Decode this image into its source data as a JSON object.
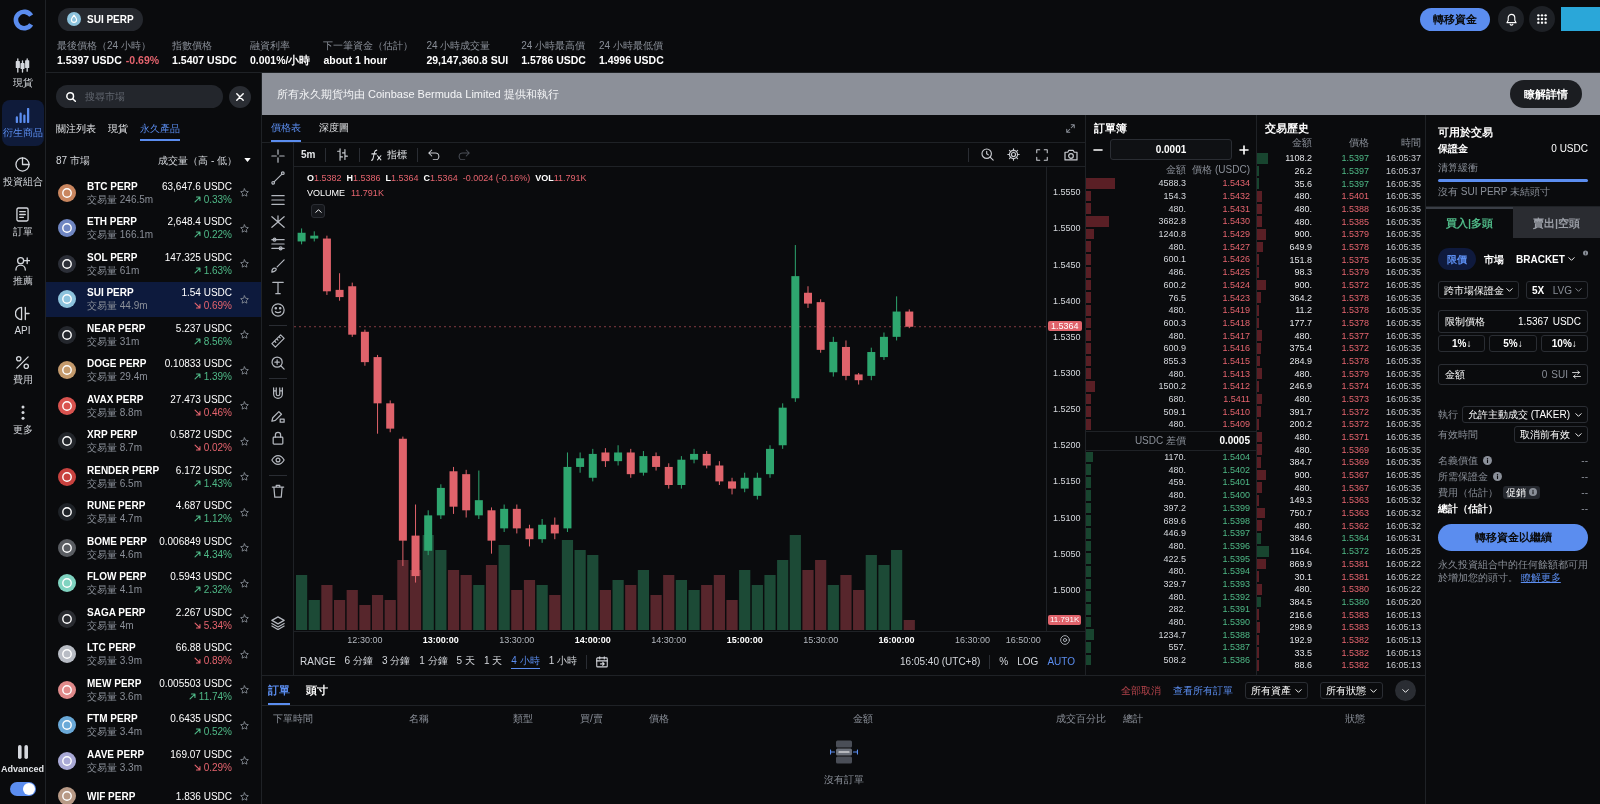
{
  "sidebar": {
    "items": [
      {
        "label": "現貨",
        "selected": false
      },
      {
        "label": "衍生商品",
        "selected": true
      },
      {
        "label": "投資組合",
        "selected": false
      },
      {
        "label": "訂單",
        "selected": false
      },
      {
        "label": "推薦",
        "selected": false
      },
      {
        "label": "API",
        "selected": false
      },
      {
        "label": "費用",
        "selected": false
      },
      {
        "label": "更多",
        "selected": false
      }
    ],
    "mode_label": "Advanced",
    "mode_toggle": {
      "on": true
    }
  },
  "header": {
    "market": "SUI PERP",
    "stats": [
      {
        "label": "最後價格（24 小時）",
        "value": "1.5397 USDC",
        "change": "-0.69%"
      },
      {
        "label": "指數價格",
        "value": "1.5407 USDC"
      },
      {
        "label": "融資利率",
        "value": "0.001%/小時"
      },
      {
        "label": "下一筆資金（估計）",
        "value": "about 1 hour"
      },
      {
        "label": "24 小時成交量",
        "value": "29,147,360.8 SUI"
      },
      {
        "label": "24 小時最高價",
        "value": "1.5786 USDC"
      },
      {
        "label": "24 小時最低價",
        "value": "1.4996 USDC"
      }
    ],
    "transfer_button": "轉移資金"
  },
  "markets": {
    "search": {
      "placeholder": "搜尋市場"
    },
    "tabs": [
      {
        "label": "關注列表",
        "selected": false
      },
      {
        "label": "現貨",
        "selected": false
      },
      {
        "label": "永久產品",
        "selected": true
      }
    ],
    "count": "87 市場",
    "sort": "成交量（高 - 低）",
    "rows": [
      {
        "name": "BTC PERP",
        "volume": "交易量 246.5m",
        "price": "63,647.6 USDC",
        "change": "0.33%",
        "rising": true,
        "selected": false,
        "color": "#c9865f"
      },
      {
        "name": "ETH PERP",
        "volume": "交易量 166.1m",
        "price": "2,648.4 USDC",
        "change": "0.22%",
        "rising": true,
        "selected": false,
        "color": "#6f86c2"
      },
      {
        "name": "SOL PERP",
        "volume": "交易量 61m",
        "price": "147.325 USDC",
        "change": "1.63%",
        "rising": true,
        "selected": false,
        "color": "#2c2f38"
      },
      {
        "name": "SUI PERP",
        "volume": "交易量 44.9m",
        "price": "1.54 USDC",
        "change": "0.69%",
        "rising": false,
        "selected": true,
        "color": "#8dc3dd"
      },
      {
        "name": "NEAR PERP",
        "volume": "交易量 31m",
        "price": "5.237 USDC",
        "change": "8.56%",
        "rising": true,
        "selected": false,
        "color": "#24272d"
      },
      {
        "name": "DOGE PERP",
        "volume": "交易量 29.4m",
        "price": "0.10833 USDC",
        "change": "1.39%",
        "rising": true,
        "selected": false,
        "color": "#c49a6c"
      },
      {
        "name": "AVAX PERP",
        "volume": "交易量 8.8m",
        "price": "27.473 USDC",
        "change": "0.46%",
        "rising": false,
        "selected": false,
        "color": "#d9534f"
      },
      {
        "name": "XRP PERP",
        "volume": "交易量 8.7m",
        "price": "0.5872 USDC",
        "change": "0.02%",
        "rising": false,
        "selected": false,
        "color": "#23262b"
      },
      {
        "name": "RENDER PERP",
        "volume": "交易量 6.5m",
        "price": "6.172 USDC",
        "change": "1.43%",
        "rising": true,
        "selected": false,
        "color": "#c8423f"
      },
      {
        "name": "RUNE PERP",
        "volume": "交易量 4.7m",
        "price": "4.687 USDC",
        "change": "1.12%",
        "rising": true,
        "selected": false,
        "color": "#1f2328"
      },
      {
        "name": "BOME PERP",
        "volume": "交易量 4.6m",
        "price": "0.006849 USDC",
        "change": "4.34%",
        "rising": true,
        "selected": false,
        "color": "#5a5d62"
      },
      {
        "name": "FLOW PERP",
        "volume": "交易量 4.1m",
        "price": "0.5943 USDC",
        "change": "2.32%",
        "rising": true,
        "selected": false,
        "color": "#7fd3c0"
      },
      {
        "name": "SAGA PERP",
        "volume": "交易量 4m",
        "price": "2.267 USDC",
        "change": "5.34%",
        "rising": false,
        "selected": false,
        "color": "#2a2c31"
      },
      {
        "name": "LTC PERP",
        "volume": "交易量 3.9m",
        "price": "66.88 USDC",
        "change": "0.89%",
        "rising": false,
        "selected": false,
        "color": "#b8bcc4"
      },
      {
        "name": "MEW PERP",
        "volume": "交易量 3.6m",
        "price": "0.005503 USDC",
        "change": "11.74%",
        "rising": true,
        "selected": false,
        "color": "#e08a8a"
      },
      {
        "name": "FTM PERP",
        "volume": "交易量 3.4m",
        "price": "0.6435 USDC",
        "change": "0.52%",
        "rising": true,
        "selected": false,
        "color": "#6aa9d8"
      },
      {
        "name": "AAVE PERP",
        "volume": "交易量 3.3m",
        "price": "169.07 USDC",
        "change": "0.29%",
        "rising": false,
        "selected": false,
        "color": "#a9a9d6"
      },
      {
        "name": "WIF PERP",
        "price": "1.836 USDC",
        "selected": false,
        "color": "#b89a86"
      }
    ]
  },
  "banner": {
    "text": "所有永久期貨均由 Coinbase Bermuda Limited 提供和執行",
    "button": "瞭解詳情"
  },
  "chart": {
    "tabs": [
      {
        "label": "價格表",
        "selected": true
      },
      {
        "label": "深度圖",
        "selected": false
      }
    ],
    "interval": "5m",
    "indicators_button": "指標",
    "legend": {
      "ohlc": [
        {
          "key": "O",
          "value": "1.5382"
        },
        {
          "key": "H",
          "value": "1.5386"
        },
        {
          "key": "L",
          "value": "1.5364"
        },
        {
          "key": "C",
          "value": "1.5364"
        }
      ],
      "change": "-0.0024 (-0.16%)",
      "volume_key": "VOL",
      "volume_value": "11.791K"
    },
    "volume_legend": {
      "label": "VOLUME",
      "value": "11.791K"
    },
    "chart_data": {
      "type": "candlestick",
      "x": [
        725,
        730,
        735,
        740,
        745,
        750,
        755,
        760,
        765,
        770,
        775,
        780,
        785,
        790,
        795,
        800,
        805,
        810,
        815,
        820,
        825,
        830,
        835,
        840,
        845,
        850,
        855,
        860,
        865,
        870,
        875,
        880,
        885,
        890,
        895,
        900,
        905,
        910,
        915,
        920,
        925,
        930,
        935,
        940,
        945,
        950,
        955,
        960,
        965
      ],
      "ohlc": [
        [
          1.5482,
          1.55,
          1.5478,
          1.5494
        ],
        [
          1.5486,
          1.5496,
          1.5482,
          1.549
        ],
        [
          1.5486,
          1.549,
          1.5408,
          1.5413
        ],
        [
          1.5415,
          1.5438,
          1.54,
          1.5405
        ],
        [
          1.542,
          1.5425,
          1.535,
          1.5353
        ],
        [
          1.5357,
          1.536,
          1.531,
          1.5315
        ],
        [
          1.5322,
          1.5325,
          1.5216,
          1.5258
        ],
        [
          1.5258,
          1.5262,
          1.5218,
          1.5223
        ],
        [
          1.5209,
          1.5212,
          1.5033,
          1.5068
        ],
        [
          1.5075,
          1.5118,
          1.501,
          1.5019
        ],
        [
          1.5054,
          1.511,
          1.5048,
          1.5103
        ],
        [
          1.5103,
          1.5146,
          1.5098,
          1.5141
        ],
        [
          1.5164,
          1.517,
          1.5105,
          1.5115
        ],
        [
          1.516,
          1.5166,
          1.51,
          1.511
        ],
        [
          1.5103,
          1.5165,
          1.5098,
          1.5124
        ],
        [
          1.511,
          1.5114,
          1.505,
          1.5068
        ],
        [
          1.5085,
          1.5118,
          1.508,
          1.5112
        ],
        [
          1.5112,
          1.5118,
          1.5078,
          1.5085
        ],
        [
          1.5085,
          1.509,
          1.506,
          1.507
        ],
        [
          1.507,
          1.5098,
          1.5065,
          1.509
        ],
        [
          1.509,
          1.51,
          1.507,
          1.5078
        ],
        [
          1.5085,
          1.519,
          1.508,
          1.517
        ],
        [
          1.517,
          1.519,
          1.5162,
          1.5182
        ],
        [
          1.5155,
          1.5195,
          1.515,
          1.5188
        ],
        [
          1.519,
          1.5196,
          1.517,
          1.5178
        ],
        [
          1.5178,
          1.52,
          1.5172,
          1.519
        ],
        [
          1.519,
          1.5195,
          1.5155,
          1.516
        ],
        [
          1.5162,
          1.5192,
          1.5158,
          1.5185
        ],
        [
          1.5185,
          1.519,
          1.5165,
          1.517
        ],
        [
          1.517,
          1.5175,
          1.514,
          1.5145
        ],
        [
          1.5145,
          1.5185,
          1.514,
          1.518
        ],
        [
          1.518,
          1.5195,
          1.5175,
          1.5188
        ],
        [
          1.5188,
          1.5192,
          1.5168,
          1.5172
        ],
        [
          1.5172,
          1.5178,
          1.5145,
          1.515
        ],
        [
          1.515,
          1.5155,
          1.5132,
          1.514
        ],
        [
          1.514,
          1.5162,
          1.5135,
          1.5155
        ],
        [
          1.513,
          1.5162,
          1.5125,
          1.5155
        ],
        [
          1.516,
          1.52,
          1.5155,
          1.5195
        ],
        [
          1.52,
          1.5258,
          1.5195,
          1.5252
        ],
        [
          1.5265,
          1.5477,
          1.526,
          1.5434
        ],
        [
          1.5411,
          1.542,
          1.539,
          1.5396
        ],
        [
          1.5398,
          1.5402,
          1.5328,
          1.5332
        ],
        [
          1.5301,
          1.535,
          1.5295,
          1.5343
        ],
        [
          1.5336,
          1.5345,
          1.529,
          1.5296
        ],
        [
          1.5298,
          1.53,
          1.5284,
          1.529
        ],
        [
          1.5296,
          1.5335,
          1.529,
          1.5329
        ],
        [
          1.5322,
          1.5356,
          1.5318,
          1.535
        ],
        [
          1.535,
          1.5406,
          1.5345,
          1.5385
        ],
        [
          1.5385,
          1.5388,
          1.5362,
          1.5364
        ]
      ],
      "xlim": [
        722,
        1034.4
      ],
      "ylim": [
        1.4943,
        1.5585
      ],
      "xticks": [
        {
          "value": 750,
          "label": "12:30:00"
        },
        {
          "value": 780,
          "label": "13:00:00"
        },
        {
          "value": 810,
          "label": "13:30:00"
        },
        {
          "value": 840,
          "label": "14:00:00"
        },
        {
          "value": 870,
          "label": "14:30:00"
        },
        {
          "value": 900,
          "label": "15:00:00"
        },
        {
          "value": 930,
          "label": "15:30:00"
        },
        {
          "value": 960,
          "label": "16:00:00"
        },
        {
          "value": 990,
          "label": "16:30:00"
        },
        {
          "value": 1010,
          "label": "16:50:00"
        }
      ],
      "yticks": [
        {
          "value": 1.555,
          "label": "1.5550"
        },
        {
          "value": 1.55,
          "label": "1.5500"
        },
        {
          "value": 1.545,
          "label": "1.5450"
        },
        {
          "value": 1.54,
          "label": "1.5400"
        },
        {
          "value": 1.535,
          "label": "1.5350"
        },
        {
          "value": 1.53,
          "label": "1.5300"
        },
        {
          "value": 1.525,
          "label": "1.5250"
        },
        {
          "value": 1.52,
          "label": "1.5200"
        },
        {
          "value": 1.515,
          "label": "1.5150"
        },
        {
          "value": 1.51,
          "label": "1.5100"
        },
        {
          "value": 1.505,
          "label": "1.5050"
        },
        {
          "value": 1.5,
          "label": "1.5000"
        }
      ],
      "ref_lines": [
        {
          "axis": "y",
          "value": 1.5364,
          "label": "1.5364"
        }
      ]
    },
    "last_volume": "11.791K",
    "range_label": "RANGE",
    "ranges": [
      {
        "label": "6 分鐘",
        "selected": false
      },
      {
        "label": "3 分鐘",
        "selected": false
      },
      {
        "label": "1 分鐘",
        "selected": false
      },
      {
        "label": "5 天",
        "selected": false
      },
      {
        "label": "1 天",
        "selected": false
      },
      {
        "label": "4 小時",
        "selected": true
      },
      {
        "label": "1 小時",
        "selected": false
      }
    ],
    "clock": "16:05:40 (UTC+8)",
    "scale_options": [
      {
        "label": "%",
        "selected": false
      },
      {
        "label": "LOG",
        "selected": false
      },
      {
        "label": "AUTO",
        "selected": true
      }
    ]
  },
  "order_book": {
    "title": "訂單簿",
    "step": "0.0001",
    "columns": [
      "金額",
      "價格 (USDC)"
    ],
    "asks": [
      {
        "amount": "4588.3",
        "price": "1.5434"
      },
      {
        "amount": "154.3",
        "price": "1.5432"
      },
      {
        "amount": "480.",
        "price": "1.5431"
      },
      {
        "amount": "3682.8",
        "price": "1.5430"
      },
      {
        "amount": "1240.8",
        "price": "1.5429"
      },
      {
        "amount": "480.",
        "price": "1.5427"
      },
      {
        "amount": "600.1",
        "price": "1.5426"
      },
      {
        "amount": "486.",
        "price": "1.5425"
      },
      {
        "amount": "600.2",
        "price": "1.5424"
      },
      {
        "amount": "76.5",
        "price": "1.5423"
      },
      {
        "amount": "480.",
        "price": "1.5419"
      },
      {
        "amount": "600.3",
        "price": "1.5418"
      },
      {
        "amount": "480.",
        "price": "1.5417"
      },
      {
        "amount": "600.9",
        "price": "1.5416"
      },
      {
        "amount": "855.3",
        "price": "1.5415"
      },
      {
        "amount": "480.",
        "price": "1.5413"
      },
      {
        "amount": "1500.2",
        "price": "1.5412"
      },
      {
        "amount": "680.",
        "price": "1.5411"
      },
      {
        "amount": "509.1",
        "price": "1.5410"
      },
      {
        "amount": "480.",
        "price": "1.5409"
      }
    ],
    "spread": {
      "label": "USDC 差價",
      "value": "0.0005"
    },
    "bids": [
      {
        "amount": "1170.",
        "price": "1.5404"
      },
      {
        "amount": "480.",
        "price": "1.5402"
      },
      {
        "amount": "459.",
        "price": "1.5401"
      },
      {
        "amount": "480.",
        "price": "1.5400"
      },
      {
        "amount": "397.2",
        "price": "1.5399"
      },
      {
        "amount": "689.6",
        "price": "1.5398"
      },
      {
        "amount": "446.9",
        "price": "1.5397"
      },
      {
        "amount": "480.",
        "price": "1.5396"
      },
      {
        "amount": "422.5",
        "price": "1.5395"
      },
      {
        "amount": "480.",
        "price": "1.5394"
      },
      {
        "amount": "329.7",
        "price": "1.5393"
      },
      {
        "amount": "480.",
        "price": "1.5392"
      },
      {
        "amount": "282.",
        "price": "1.5391"
      },
      {
        "amount": "480.",
        "price": "1.5390"
      },
      {
        "amount": "1234.7",
        "price": "1.5388"
      },
      {
        "amount": "557.",
        "price": "1.5387"
      },
      {
        "amount": "508.2",
        "price": "1.5386"
      }
    ]
  },
  "trade_history": {
    "title": "交易歷史",
    "columns": [
      "金額",
      "價格",
      "時間"
    ],
    "rows": [
      {
        "amount": "1108.2",
        "price": "1.5397",
        "time": "16:05:37",
        "kind": "buy"
      },
      {
        "amount": "26.2",
        "price": "1.5397",
        "time": "16:05:37",
        "kind": "buy"
      },
      {
        "amount": "35.6",
        "price": "1.5397",
        "time": "16:05:35",
        "kind": "buy"
      },
      {
        "amount": "480.",
        "price": "1.5401",
        "time": "16:05:35",
        "kind": "sell"
      },
      {
        "amount": "480.",
        "price": "1.5388",
        "time": "16:05:35",
        "kind": "sell"
      },
      {
        "amount": "480.",
        "price": "1.5385",
        "time": "16:05:35",
        "kind": "sell"
      },
      {
        "amount": "900.",
        "price": "1.5379",
        "time": "16:05:35",
        "kind": "sell"
      },
      {
        "amount": "649.9",
        "price": "1.5378",
        "time": "16:05:35",
        "kind": "sell"
      },
      {
        "amount": "151.8",
        "price": "1.5375",
        "time": "16:05:35",
        "kind": "sell"
      },
      {
        "amount": "98.3",
        "price": "1.5379",
        "time": "16:05:35",
        "kind": "sell"
      },
      {
        "amount": "900.",
        "price": "1.5372",
        "time": "16:05:35",
        "kind": "sell"
      },
      {
        "amount": "364.2",
        "price": "1.5378",
        "time": "16:05:35",
        "kind": "sell"
      },
      {
        "amount": "11.2",
        "price": "1.5378",
        "time": "16:05:35",
        "kind": "sell"
      },
      {
        "amount": "177.7",
        "price": "1.5378",
        "time": "16:05:35",
        "kind": "sell"
      },
      {
        "amount": "480.",
        "price": "1.5377",
        "time": "16:05:35",
        "kind": "sell"
      },
      {
        "amount": "375.4",
        "price": "1.5372",
        "time": "16:05:35",
        "kind": "sell"
      },
      {
        "amount": "284.9",
        "price": "1.5378",
        "time": "16:05:35",
        "kind": "sell"
      },
      {
        "amount": "480.",
        "price": "1.5379",
        "time": "16:05:35",
        "kind": "sell"
      },
      {
        "amount": "246.9",
        "price": "1.5374",
        "time": "16:05:35",
        "kind": "sell"
      },
      {
        "amount": "480.",
        "price": "1.5373",
        "time": "16:05:35",
        "kind": "sell"
      },
      {
        "amount": "391.7",
        "price": "1.5372",
        "time": "16:05:35",
        "kind": "sell"
      },
      {
        "amount": "200.2",
        "price": "1.5372",
        "time": "16:05:35",
        "kind": "sell"
      },
      {
        "amount": "480.",
        "price": "1.5371",
        "time": "16:05:35",
        "kind": "sell"
      },
      {
        "amount": "480.",
        "price": "1.5369",
        "time": "16:05:35",
        "kind": "sell"
      },
      {
        "amount": "384.7",
        "price": "1.5369",
        "time": "16:05:35",
        "kind": "sell"
      },
      {
        "amount": "900.",
        "price": "1.5367",
        "time": "16:05:35",
        "kind": "sell"
      },
      {
        "amount": "480.",
        "price": "1.5367",
        "time": "16:05:35",
        "kind": "sell"
      },
      {
        "amount": "149.3",
        "price": "1.5363",
        "time": "16:05:32",
        "kind": "sell"
      },
      {
        "amount": "750.7",
        "price": "1.5363",
        "time": "16:05:32",
        "kind": "sell"
      },
      {
        "amount": "480.",
        "price": "1.5362",
        "time": "16:05:32",
        "kind": "sell"
      },
      {
        "amount": "384.6",
        "price": "1.5364",
        "time": "16:05:31",
        "kind": "buy"
      },
      {
        "amount": "1164.",
        "price": "1.5372",
        "time": "16:05:25",
        "kind": "buy"
      },
      {
        "amount": "869.9",
        "price": "1.5381",
        "time": "16:05:22",
        "kind": "sell"
      },
      {
        "amount": "30.1",
        "price": "1.5381",
        "time": "16:05:22",
        "kind": "sell"
      },
      {
        "amount": "480.",
        "price": "1.5380",
        "time": "16:05:22",
        "kind": "sell"
      },
      {
        "amount": "384.5",
        "price": "1.5380",
        "time": "16:05:20",
        "kind": "buy"
      },
      {
        "amount": "216.6",
        "price": "1.5383",
        "time": "16:05:13",
        "kind": "sell"
      },
      {
        "amount": "298.9",
        "price": "1.5383",
        "time": "16:05:13",
        "kind": "sell"
      },
      {
        "amount": "192.9",
        "price": "1.5382",
        "time": "16:05:13",
        "kind": "sell"
      },
      {
        "amount": "33.5",
        "price": "1.5382",
        "time": "16:05:13",
        "kind": "sell"
      },
      {
        "amount": "88.6",
        "price": "1.5382",
        "time": "16:05:13",
        "kind": "sell"
      }
    ]
  },
  "order_panel": {
    "title": "可用於交易",
    "margin": {
      "label": "保證金",
      "value": "0 USDC"
    },
    "buffer_label": "清算緩衝",
    "note": "沒有 SUI PERP 未結頭寸",
    "sides": [
      {
        "label": "買入|多頭",
        "selected": true
      },
      {
        "label": "賣出|空頭",
        "selected": false
      }
    ],
    "order_types": [
      {
        "label": "限價",
        "selected": true,
        "dropdown": false
      },
      {
        "label": "市場",
        "selected": false,
        "dropdown": false
      },
      {
        "label": "BRACKET",
        "selected": false,
        "dropdown": true
      }
    ],
    "margin_mode": "跨市場保證金",
    "leverage": {
      "value": "5X",
      "unit": "LVG"
    },
    "limit_price": {
      "label": "限制價格",
      "value": "1.5367",
      "unit": "USDC"
    },
    "percent_buttons": [
      "1%↓",
      "5%↓",
      "10%↓"
    ],
    "amount": {
      "label": "金額",
      "value": "0",
      "unit": "SUI"
    },
    "execution": {
      "label": "執行",
      "value": "允許主動成交 (TAKER)"
    },
    "time_in_force": {
      "label": "有效時間",
      "value": "取消前有效"
    },
    "summary": [
      {
        "label": "名義價值",
        "value": "--",
        "kind": "info"
      },
      {
        "label": "所需保證金",
        "value": "--",
        "kind": "info"
      },
      {
        "label": "費用（估計）",
        "value": "--",
        "kind": "promo",
        "badge": "促銷"
      },
      {
        "label": "總計（估計）",
        "value": "--",
        "kind": "total"
      }
    ],
    "submit": "轉移資金以繼續",
    "disclaimer": "永久投資組合中的任何餘額都可用於增加您的頭寸。",
    "link": "瞭解更多"
  },
  "orders": {
    "tabs": [
      {
        "label": "訂單",
        "selected": true
      },
      {
        "label": "頭寸",
        "selected": false
      }
    ],
    "cancel_all": "全部取消",
    "view_all": "查看所有訂單",
    "filters": [
      "所有資產",
      "所有狀態"
    ],
    "columns": [
      "下單時間",
      "名稱",
      "類型",
      "買/賣",
      "價格",
      "金額",
      "成交百分比",
      "總計",
      "狀態"
    ],
    "empty_message": "沒有訂單"
  }
}
